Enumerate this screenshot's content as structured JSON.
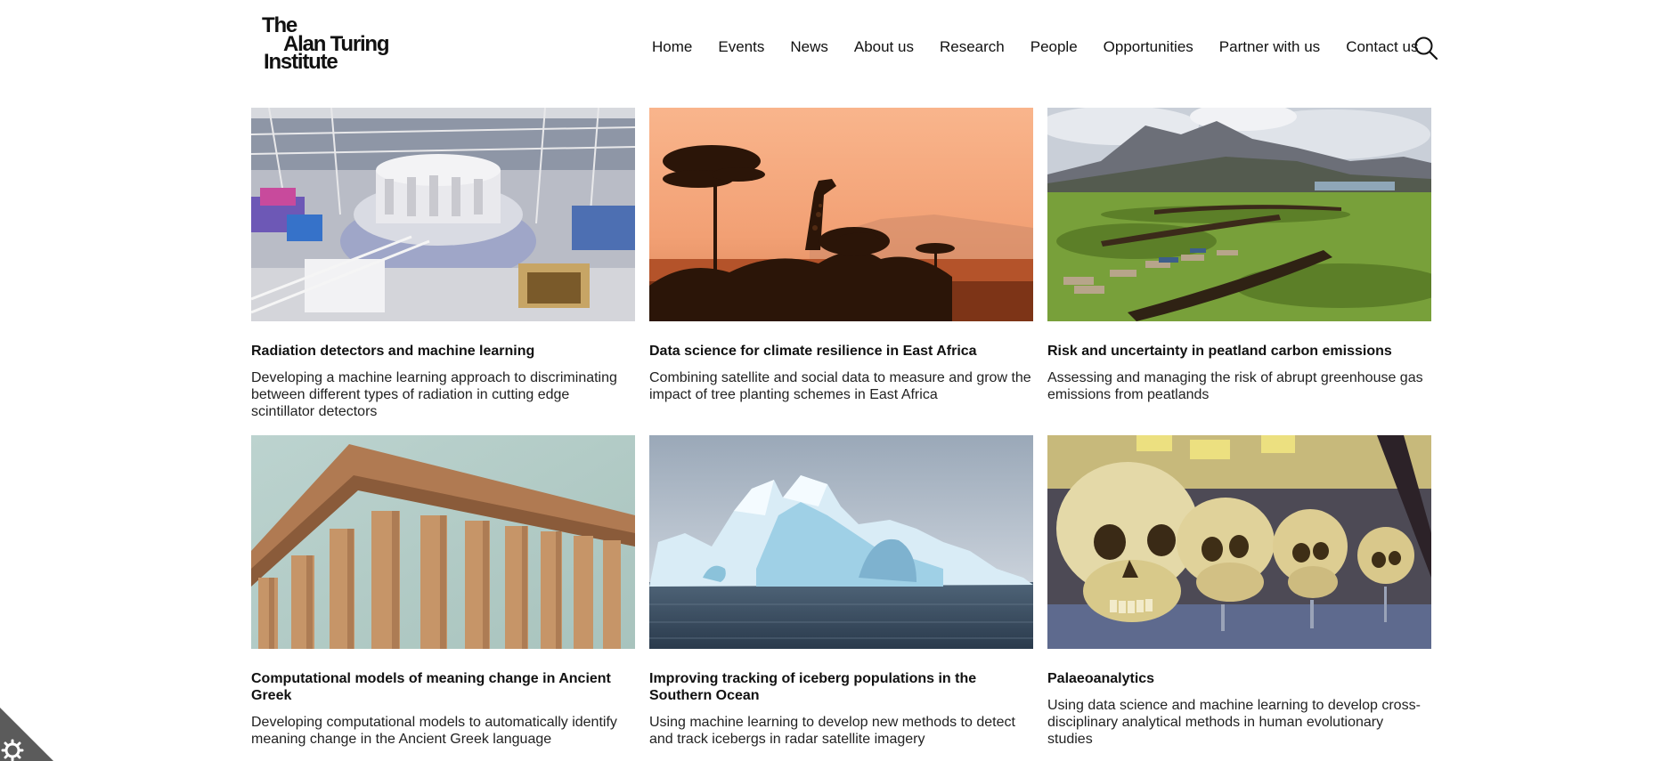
{
  "logo": {
    "line1": "The",
    "line2": "Alan Turing",
    "line3": "Institute"
  },
  "nav": [
    "Home",
    "Events",
    "News",
    "About us",
    "Research",
    "People",
    "Opportunities",
    "Partner with us",
    "Contact us"
  ],
  "cards": [
    {
      "title": "Radiation detectors and machine learning",
      "desc": "Developing a machine learning approach to discriminating between different types of radiation in cutting edge scintillator detectors"
    },
    {
      "title": "Data science for climate resilience in East Africa",
      "desc": "Combining satellite and social data to measure and grow the impact of tree planting schemes in East Africa"
    },
    {
      "title": "Risk and uncertainty in peatland carbon emissions",
      "desc": "Assessing and managing the risk of abrupt greenhouse gas emissions from peatlands"
    },
    {
      "title": "Computational models of meaning change in Ancient Greek",
      "desc": "Developing computational models to automatically identify meaning change in the Ancient Greek language"
    },
    {
      "title": "Improving tracking of iceberg populations in the Southern Ocean",
      "desc": "Using machine learning to develop new methods to detect and track icebergs in radar satellite imagery"
    },
    {
      "title": "Palaeoanalytics",
      "desc": "Using data science and machine learning to develop cross-disciplinary analytical methods in human evolutionary studies"
    }
  ]
}
